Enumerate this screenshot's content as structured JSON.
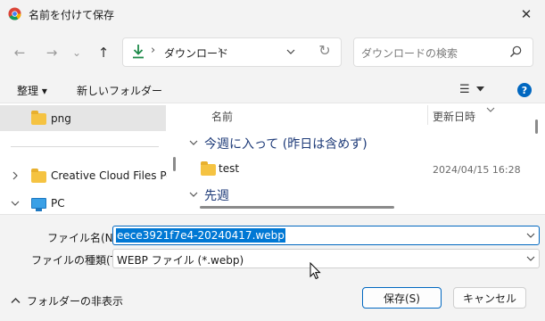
{
  "window": {
    "title": "名前を付けて保存",
    "close_glyph": "✕"
  },
  "nav": {
    "back_glyph": "←",
    "forward_glyph": "→",
    "recent_glyph": "⌄",
    "up_glyph": "↑",
    "breadcrumb_sep": "›",
    "path_label": "ダウンロード",
    "refresh_glyph": "↻",
    "search_placeholder": "ダウンロードの検索"
  },
  "toolbar": {
    "organize_label": "整理 ▾",
    "new_folder_label": "新しいフォルダー",
    "view_glyph": "☰",
    "help_glyph": "?"
  },
  "sidebar": {
    "items": [
      {
        "label": "png",
        "icon": "folder-icon"
      },
      {
        "label": "Creative Cloud Files Perso",
        "icon": "folder-icon"
      },
      {
        "label": "PC",
        "icon": "pc-icon"
      }
    ]
  },
  "file_list": {
    "col_name": "名前",
    "col_date": "更新日時",
    "groups": [
      {
        "label": "今週に入って (昨日は含めず)",
        "items": [
          {
            "name": "test",
            "date": "2024/04/15 16:28"
          }
        ]
      },
      {
        "label": "先週",
        "items": []
      }
    ]
  },
  "form": {
    "filename_label": "ファイル名(N):",
    "filename_value": "eece3921f7e4-20240417.webp",
    "filetype_label": "ファイルの種類(T):",
    "filetype_value": "WEBP ファイル (*.webp)"
  },
  "footer": {
    "hide_folders_label": "フォルダーの非表示",
    "save_label": "保存(S)",
    "cancel_label": "キャンセル"
  },
  "colors": {
    "accent": "#0078d4",
    "help": "#0067c0",
    "download_arrow": "#1e8a4a"
  }
}
